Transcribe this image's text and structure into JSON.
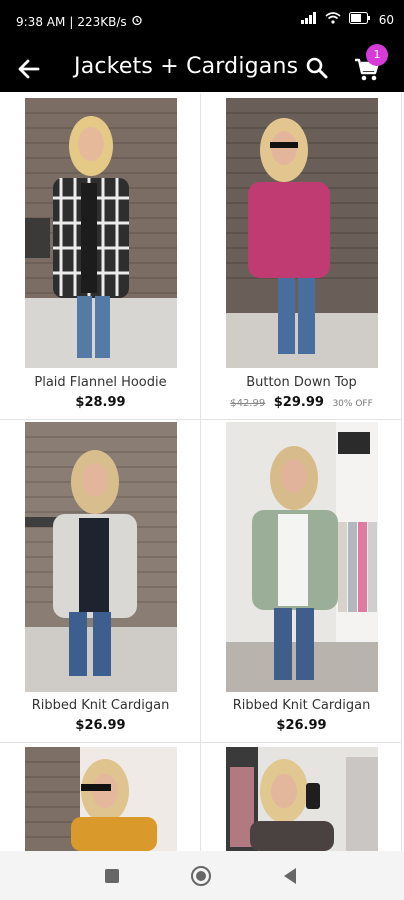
{
  "status_bar": {
    "time": "9:38 AM",
    "speed": "223KB/s",
    "battery": "60"
  },
  "header": {
    "title": "Jackets + Cardigans",
    "cart_count": "1"
  },
  "products": [
    {
      "name": "Plaid Flannel Hoodie",
      "price": "$28.99",
      "original_price": "",
      "discount": ""
    },
    {
      "name": "Button Down Top",
      "price": "$29.99",
      "original_price": "$42.99",
      "discount": "30% OFF"
    },
    {
      "name": "Ribbed Knit Cardigan",
      "price": "$26.99",
      "original_price": "",
      "discount": ""
    },
    {
      "name": "Ribbed Knit Cardigan",
      "price": "$26.99",
      "original_price": "",
      "discount": ""
    }
  ],
  "icons": {
    "back": "back-arrow-icon",
    "search": "search-icon",
    "cart": "shopping-cart-icon"
  },
  "colors": {
    "header_bg": "#000000",
    "badge": "#d63bd8"
  }
}
